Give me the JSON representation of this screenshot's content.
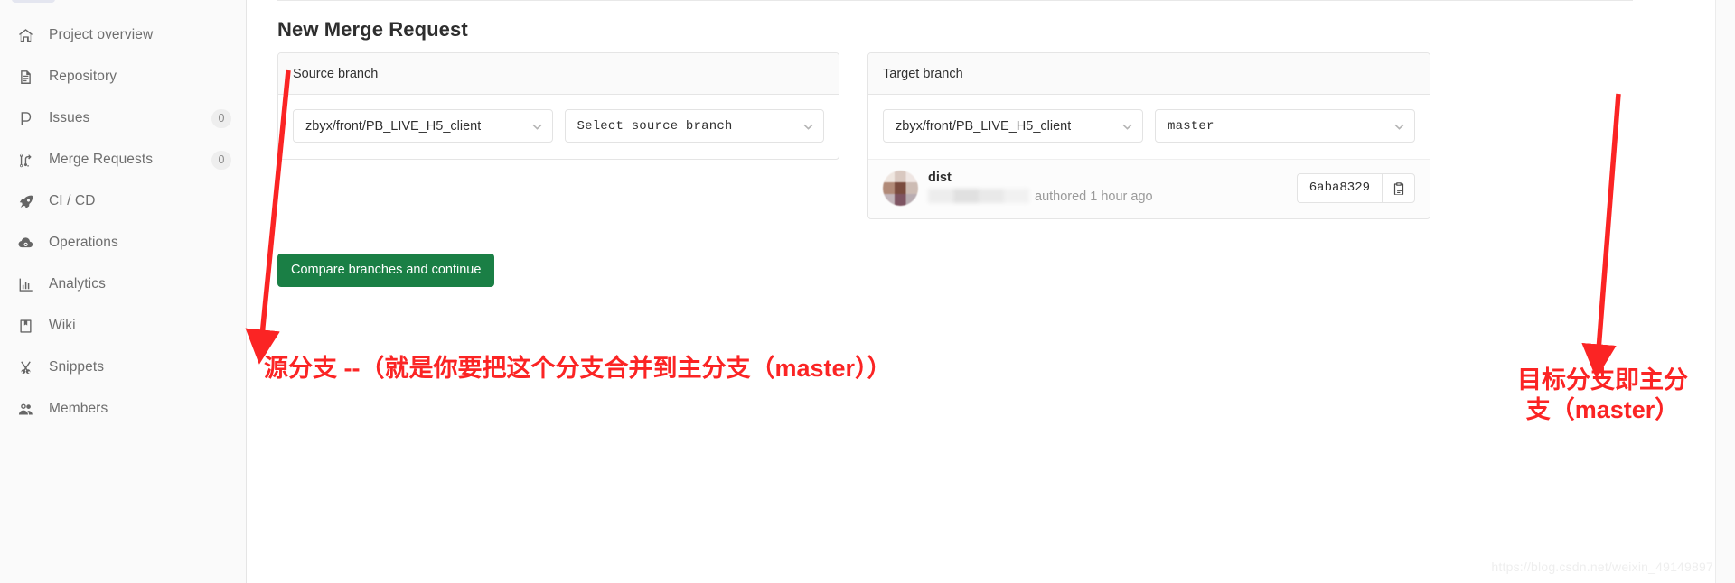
{
  "sidebar": {
    "items": [
      {
        "label": "Project overview",
        "icon": "home-icon",
        "badge": null
      },
      {
        "label": "Repository",
        "icon": "document-icon",
        "badge": null
      },
      {
        "label": "Issues",
        "icon": "issue-icon",
        "badge": "0"
      },
      {
        "label": "Merge Requests",
        "icon": "merge-request-icon",
        "badge": "0"
      },
      {
        "label": "CI / CD",
        "icon": "rocket-icon",
        "badge": null
      },
      {
        "label": "Operations",
        "icon": "cloud-gear-icon",
        "badge": null
      },
      {
        "label": "Analytics",
        "icon": "bar-chart-icon",
        "badge": null
      },
      {
        "label": "Wiki",
        "icon": "book-icon",
        "badge": null
      },
      {
        "label": "Snippets",
        "icon": "scissors-icon",
        "badge": null
      },
      {
        "label": "Members",
        "icon": "people-icon",
        "badge": null
      }
    ]
  },
  "main": {
    "page_title": "New Merge Request",
    "source_panel": {
      "heading": "Source branch",
      "project_select": "zbyx/front/PB_LIVE_H5_client",
      "branch_select": "Select source branch"
    },
    "target_panel": {
      "heading": "Target branch",
      "project_select": "zbyx/front/PB_LIVE_H5_client",
      "branch_select": "master",
      "commit": {
        "title": "dist",
        "author": "",
        "authored_text": "authored 1 hour ago",
        "sha": "6aba8329",
        "copy_label": "copy-commit-sha"
      }
    },
    "compare_button": "Compare branches and continue"
  },
  "annotations": {
    "left": "源分支 --（就是你要把这个分支合并到主分支（master））",
    "right": "目标分支即主分支（master）",
    "color": "#fb2424"
  },
  "watermark": "https://blog.csdn.net/weixin_49149897",
  "colors": {
    "primary_button": "#1a7f45",
    "sidebar_bg": "#fafafa",
    "annotation_red": "#fb2424"
  }
}
